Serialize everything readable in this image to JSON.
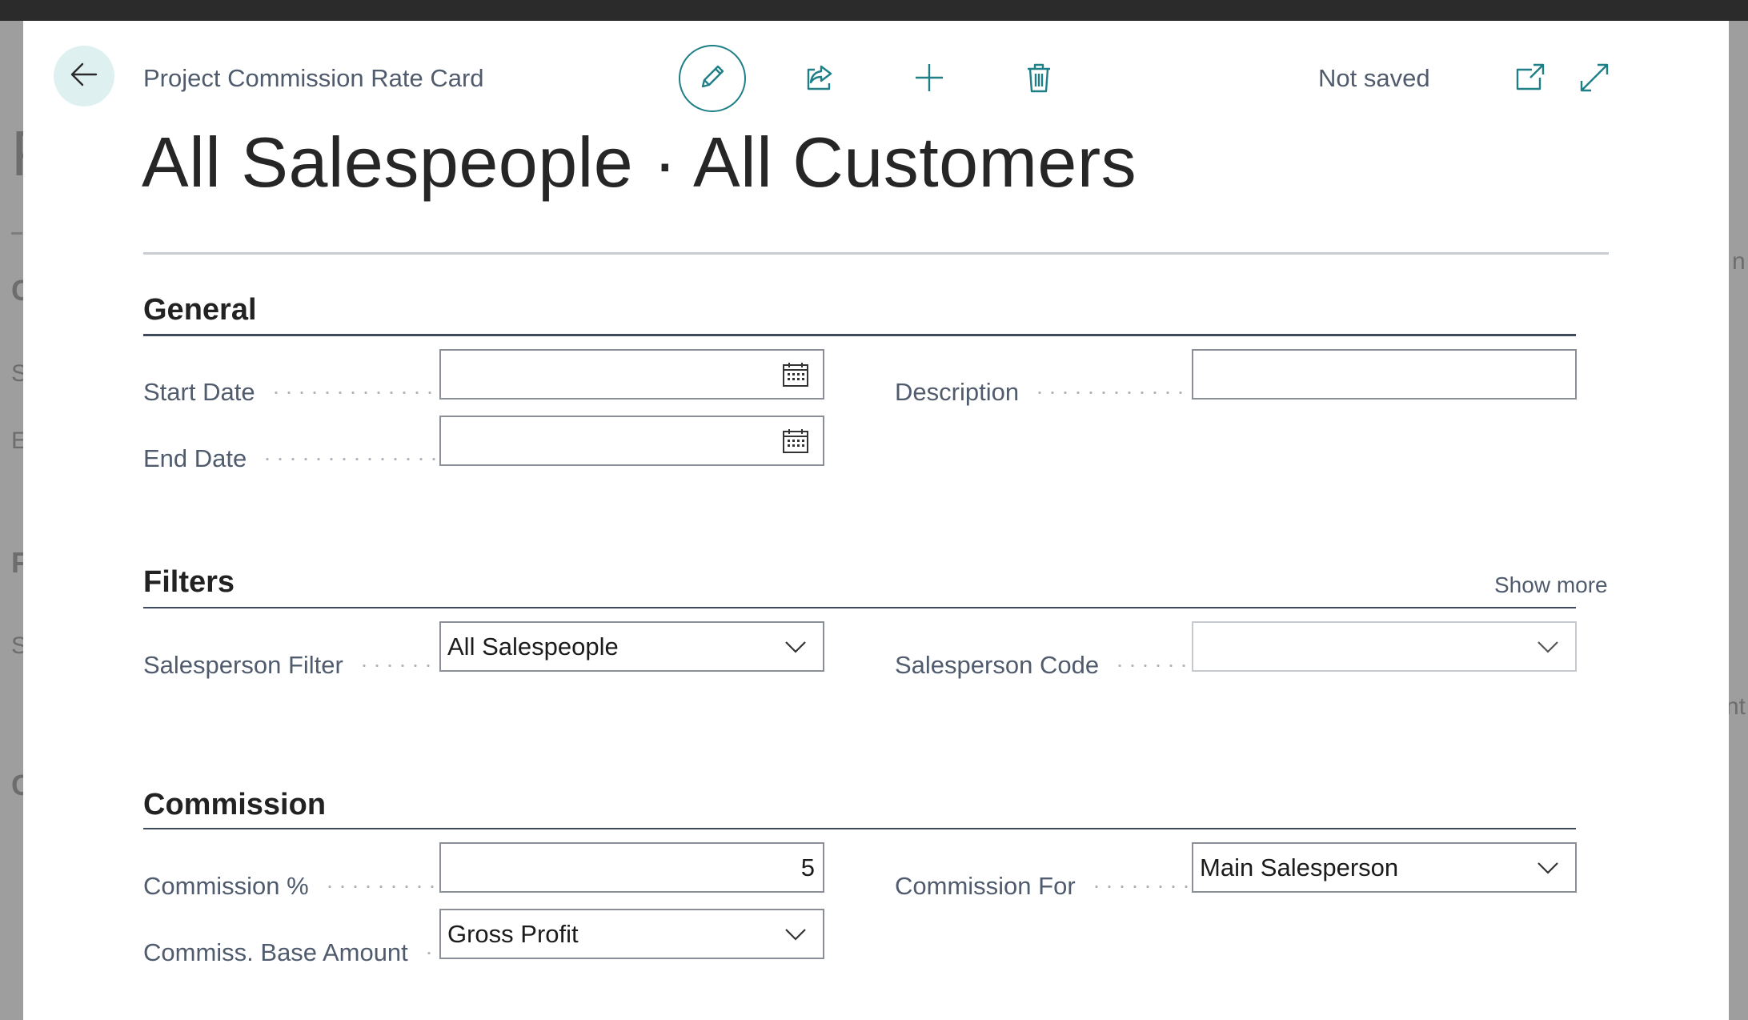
{
  "background": {
    "fragments": [
      "P",
      "C",
      "S",
      "E",
      "F",
      "S",
      "C",
      "n",
      "nt"
    ]
  },
  "header": {
    "caption": "Project Commission Rate Card",
    "status": "Not saved"
  },
  "icons": {
    "back": "arrow-left-icon",
    "edit": "pencil-icon",
    "share": "share-icon",
    "new": "plus-icon",
    "delete": "trash-icon",
    "open_new_window": "open-in-new-window-icon",
    "expand": "expand-icon",
    "calendar": "calendar-icon",
    "dropdown": "chevron-down-icon"
  },
  "title": "All Salespeople · All Customers",
  "sections": {
    "general": {
      "title": "General",
      "start_date": {
        "label": "Start Date",
        "value": ""
      },
      "end_date": {
        "label": "End Date",
        "value": ""
      },
      "description": {
        "label": "Description",
        "value": ""
      }
    },
    "filters": {
      "title": "Filters",
      "show_more": "Show more",
      "salesperson_filter": {
        "label": "Salesperson Filter",
        "value": "All Salespeople"
      },
      "salesperson_code": {
        "label": "Salesperson Code",
        "value": ""
      }
    },
    "commission": {
      "title": "Commission",
      "commission_pct": {
        "label": "Commission %",
        "value": "5"
      },
      "commission_for": {
        "label": "Commission For",
        "value": "Main Salesperson"
      },
      "base_amount": {
        "label": "Commiss. Base Amount",
        "value": "Gross Profit"
      }
    }
  },
  "colors": {
    "accent": "#1f7f86",
    "back_button_bg": "#dff0f1",
    "label": "#505c6d",
    "section_rule": "#3f4a5d"
  }
}
